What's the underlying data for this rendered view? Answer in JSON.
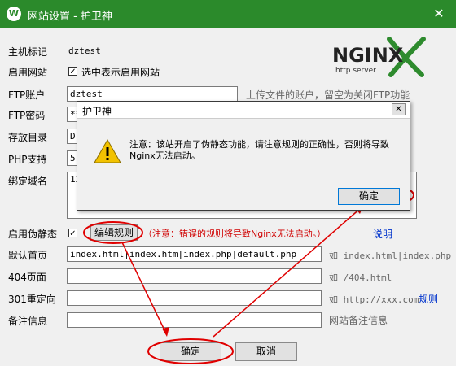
{
  "window": {
    "title": "网站设置 - 护卫神",
    "logo_glyph": "W",
    "close_glyph": "✕"
  },
  "logo": {
    "main": "NGINX",
    "sub": "http server"
  },
  "form": {
    "host_label": "主机标记",
    "host_value": "dztest",
    "enable_label": "启用网站",
    "enable_checkbox_text": "选中表示启用网站",
    "check_glyph": "✓",
    "ftp_user_label": "FTP账户",
    "ftp_user_value": "dztest",
    "ftp_user_hint": "上传文件的账户，留空为关闭FTP功能",
    "ftp_pass_label": "FTP密码",
    "ftp_pass_value": "**",
    "dir_label": "存放目录",
    "dir_value": "D:",
    "php_label": "PHP支持",
    "php_value": "5.",
    "domain_label": "绑定域名",
    "domain_value": "12",
    "pseudo_label": "启用伪静态",
    "pseudo_button": "编辑规则",
    "pseudo_warning": "（注意：错误的规则将导致Nginx无法启动。）",
    "pseudo_help": "说明",
    "index_label": "默认首页",
    "index_value": "index.html|index.htm|index.php|default.php",
    "index_hint": "如 index.html|index.php",
    "page404_label": "404页面",
    "page404_hint": "如 /404.html",
    "redirect_label": "301重定向",
    "redirect_hint": "如 http://xxx.com",
    "redirect_link": "规则",
    "note_label": "备注信息",
    "note_hint": "网站备注信息"
  },
  "buttons": {
    "ok": "确定",
    "cancel": "取消"
  },
  "dialog": {
    "title": "护卫神",
    "close_glyph": "✕",
    "message": "注意：该站开启了伪静态功能，请注意规则的正确性，否则将导致Nginx无法启动。",
    "ok": "确定",
    "warning_glyph": "!"
  },
  "colors": {
    "titlebar": "#2b8a2b",
    "annotation": "#e00000",
    "warning_yellow": "#f2c200"
  }
}
